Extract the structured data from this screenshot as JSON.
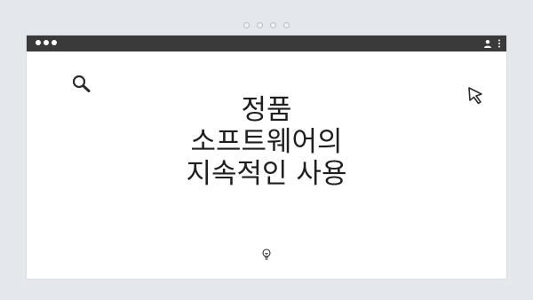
{
  "window": {
    "titlebar_color": "#3a3a3a",
    "background": "#ffffff",
    "icons": [
      "user-icon",
      "more-vertical-icon"
    ]
  },
  "content": {
    "title_lines": [
      "정품",
      "소프트웨어의",
      "지속적인 사용"
    ],
    "icons": [
      "search-icon",
      "cursor-icon",
      "lightbulb-icon"
    ]
  },
  "colors": {
    "page_background": "#e4e8ed",
    "text": "#1f1f1f"
  }
}
